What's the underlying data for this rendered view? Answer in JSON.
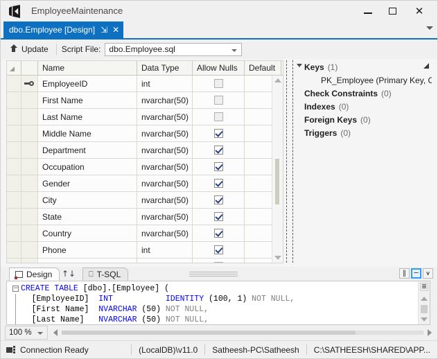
{
  "window": {
    "title": "EmployeeMaintenance",
    "logo_icon": "visual-studio-logo",
    "minimize_label": "–",
    "maximize_label": "□",
    "close_label": "✕"
  },
  "document_tab": {
    "label": "dbo.Employee [Design]",
    "pin_icon": "⇲",
    "close_icon": "✕",
    "overflow_icon": "chevron-down-icon"
  },
  "toolbar": {
    "update_label": "Update",
    "update_icon": "update-arrow-icon",
    "script_file_label": "Script File:",
    "script_file_value": "dbo.Employee.sql",
    "script_file_dropdown_icon": "chevron-down-icon"
  },
  "grid": {
    "columns": [
      "",
      "",
      "Name",
      "Data Type",
      "Allow Nulls",
      "Default"
    ],
    "rows": [
      {
        "key": true,
        "name": "EmployeeID",
        "type": "int",
        "allow_nulls": false,
        "nulls_disabled": true,
        "default": ""
      },
      {
        "key": false,
        "name": "First Name",
        "type": "nvarchar(50)",
        "allow_nulls": false,
        "nulls_disabled": true,
        "default": ""
      },
      {
        "key": false,
        "name": "Last Name",
        "type": "nvarchar(50)",
        "allow_nulls": false,
        "nulls_disabled": true,
        "default": ""
      },
      {
        "key": false,
        "name": "Middle Name",
        "type": "nvarchar(50)",
        "allow_nulls": true,
        "nulls_disabled": false,
        "default": ""
      },
      {
        "key": false,
        "name": "Department",
        "type": "nvarchar(50)",
        "allow_nulls": true,
        "nulls_disabled": false,
        "default": ""
      },
      {
        "key": false,
        "name": "Occupation",
        "type": "nvarchar(50)",
        "allow_nulls": true,
        "nulls_disabled": false,
        "default": ""
      },
      {
        "key": false,
        "name": "Gender",
        "type": "nvarchar(50)",
        "allow_nulls": true,
        "nulls_disabled": false,
        "default": ""
      },
      {
        "key": false,
        "name": "City",
        "type": "nvarchar(50)",
        "allow_nulls": true,
        "nulls_disabled": false,
        "default": ""
      },
      {
        "key": false,
        "name": "State",
        "type": "nvarchar(50)",
        "allow_nulls": true,
        "nulls_disabled": false,
        "default": ""
      },
      {
        "key": false,
        "name": "Country",
        "type": "nvarchar(50)",
        "allow_nulls": true,
        "nulls_disabled": false,
        "default": ""
      },
      {
        "key": false,
        "name": "Phone",
        "type": "int",
        "allow_nulls": true,
        "nulls_disabled": false,
        "default": ""
      },
      {
        "key": false,
        "name": "",
        "type": "",
        "allow_nulls": false,
        "nulls_disabled": true,
        "default": ""
      }
    ]
  },
  "tree": {
    "nodes": [
      {
        "label": "Keys",
        "count": "(1)",
        "expanded": true,
        "child": "PK_Employee  (Primary Key, Clu"
      },
      {
        "label": "Check Constraints",
        "count": "(0)",
        "expanded": false,
        "child": ""
      },
      {
        "label": "Indexes",
        "count": "(0)",
        "expanded": false,
        "child": ""
      },
      {
        "label": "Foreign Keys",
        "count": "(0)",
        "expanded": false,
        "child": ""
      },
      {
        "label": "Triggers",
        "count": "(0)",
        "expanded": false,
        "child": ""
      }
    ]
  },
  "sql_pane": {
    "design_tab_label": "Design",
    "tsql_tab_label": "T-SQL",
    "swap_icon": "↑↓",
    "split_buttons": [
      "‖",
      "─",
      "⩛"
    ],
    "selected_split_index": 1,
    "code": [
      {
        "outline": true,
        "text": "CREATE TABLE [dbo].[Employee] ("
      },
      {
        "outline": false,
        "text": "    [EmployeeID]  INT           IDENTITY (100, 1) NOT NULL,"
      },
      {
        "outline": false,
        "text": "    [First Name]  NVARCHAR (50) NOT NULL,"
      },
      {
        "outline": false,
        "text": "    [Last Name]   NVARCHAR (50) NOT NULL,"
      }
    ]
  },
  "zoom_bar": {
    "zoom_value": "100 %",
    "zoom_dropdown_icon": "chevron-down-icon",
    "scroll_left_icon": "caret-left-icon",
    "scroll_right_icon": "caret-right-icon"
  },
  "status_bar": {
    "connection_icon": "connection-icon",
    "connection_text": "Connection Ready",
    "server": "(LocalDB)\\v11.0",
    "user": "Satheesh-PC\\Satheesh",
    "path": "C:\\SATHEESH\\SHARED\\APP..."
  }
}
